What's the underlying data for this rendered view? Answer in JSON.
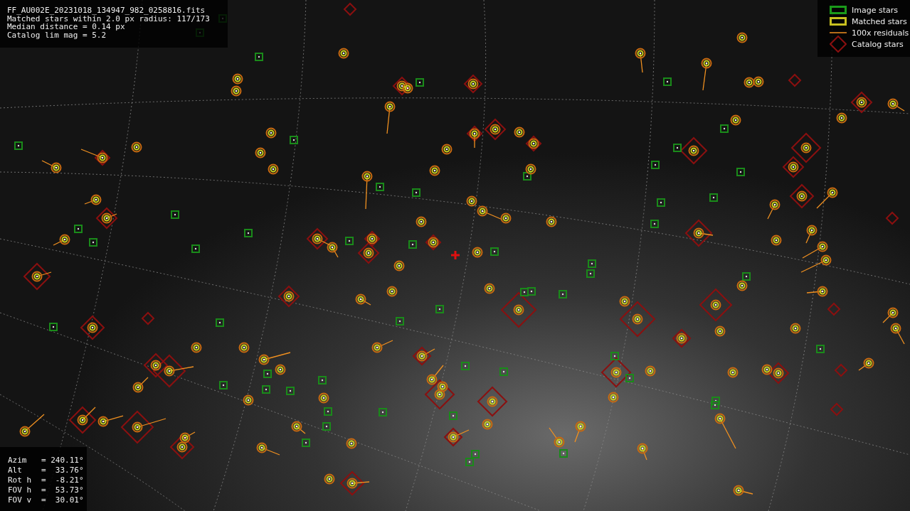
{
  "info_lines": [
    "FF_AU002E_20231018_134947_982_0258816.fits",
    "Matched stars within 2.0 px radius: 117/173",
    "Median distance = 0.14 px",
    "Catalog lim mag = 5.2"
  ],
  "legend": [
    {
      "kind": "image",
      "label": "Image stars"
    },
    {
      "kind": "matched",
      "label": "Matched stars"
    },
    {
      "kind": "residual",
      "label": "100x residuals"
    },
    {
      "kind": "catalog",
      "label": "Catalog stars"
    }
  ],
  "pointing": [
    {
      "label": "Azim",
      "value": "= 240.11°"
    },
    {
      "label": "Alt",
      "value": "=  33.76°"
    },
    {
      "label": "Rot h",
      "value": "=  -8.21°"
    },
    {
      "label": "FOV h",
      "value": "=  53.73°"
    },
    {
      "label": "FOV v",
      "value": "=  30.01°"
    }
  ]
}
